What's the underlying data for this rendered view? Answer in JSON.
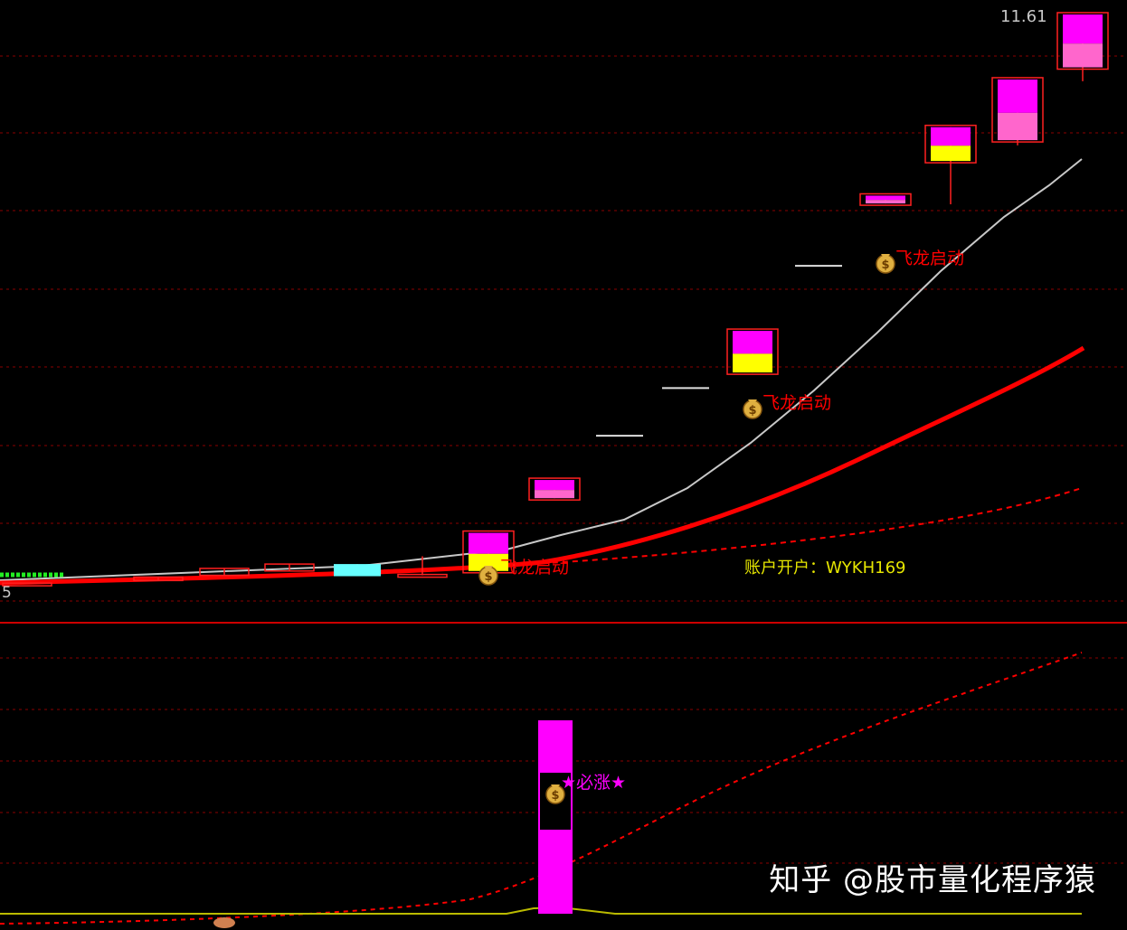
{
  "chart_data": {
    "type": "candlestick",
    "price_label_top": "11.61",
    "price_label_left": "5",
    "signal_labels": [
      "飞龙启动",
      "飞龙启动",
      "飞龙启动"
    ],
    "account_text": "账户开户：WYKH169",
    "lower_signal_label": "★必涨★",
    "candles": [
      {
        "open": 5.05,
        "close": 5.05,
        "high": 5.05,
        "low": 5.05,
        "fill": "outline"
      },
      {
        "open": 5.08,
        "close": 5.12,
        "high": 5.12,
        "low": 5.08,
        "fill": "outline"
      },
      {
        "open": 5.14,
        "close": 5.22,
        "high": 5.22,
        "low": 5.14,
        "fill": "outline"
      },
      {
        "open": 5.19,
        "close": 5.27,
        "high": 5.27,
        "low": 5.19,
        "fill": "outline"
      },
      {
        "open": 5.13,
        "close": 5.27,
        "high": 5.27,
        "low": 5.13,
        "fill": "cyan"
      },
      {
        "open": 5.14,
        "close": 5.15,
        "high": 5.36,
        "low": 5.14,
        "fill": "outline"
      },
      {
        "open": 5.19,
        "close": 5.63,
        "high": 5.63,
        "low": 5.19,
        "fill": "magenta-yellow"
      },
      {
        "open": 6.03,
        "close": 6.24,
        "high": 6.24,
        "low": 6.03,
        "fill": "magenta-pink"
      },
      {
        "open": 6.75,
        "close": 6.75,
        "high": 6.75,
        "low": 6.75,
        "fill": "dash"
      },
      {
        "open": 7.3,
        "close": 7.3,
        "high": 7.3,
        "low": 7.3,
        "fill": "dash"
      },
      {
        "open": 7.48,
        "close": 7.96,
        "high": 7.96,
        "low": 7.48,
        "fill": "magenta-yellow"
      },
      {
        "open": 8.71,
        "close": 8.71,
        "high": 8.71,
        "low": 8.71,
        "fill": "dash"
      },
      {
        "open": 9.43,
        "close": 9.52,
        "high": 9.52,
        "low": 9.43,
        "fill": "magenta-pink"
      },
      {
        "open": 9.92,
        "close": 10.31,
        "high": 10.31,
        "low": 9.42,
        "fill": "magenta-yellow"
      },
      {
        "open": 10.16,
        "close": 10.86,
        "high": 10.86,
        "low": 10.1,
        "fill": "magenta-pink"
      },
      {
        "open": 11.0,
        "close": 11.61,
        "high": 11.61,
        "low": 10.84,
        "fill": "magenta-pink"
      }
    ],
    "lower_bar": {
      "value": 1.0
    },
    "colors": {
      "background": "#000000",
      "grid": "#8b0000",
      "divider": "#cc0000",
      "up_outline": "#ff2020",
      "magenta": "#ff00ff",
      "pink": "#ff66cc",
      "yellow": "#ffff00",
      "cyan": "#66ffff",
      "white_line": "#c8c8c8",
      "red_line": "#ff0000",
      "label_red": "#ff0000",
      "label_yellow": "#e6e600",
      "label_magenta": "#ff00ff",
      "price_text": "#c8c8c8"
    }
  },
  "watermark": "知乎 @股市量化程序猿"
}
